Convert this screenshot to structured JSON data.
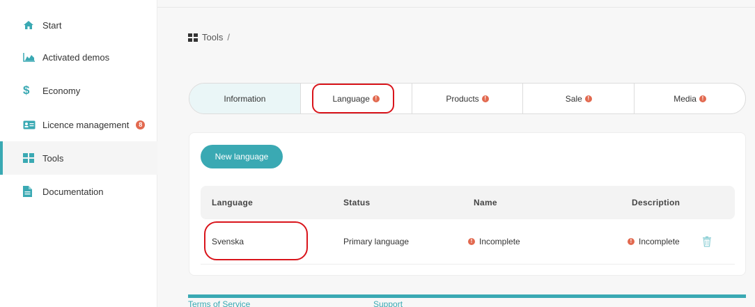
{
  "sidebar": {
    "items": [
      {
        "label": "Start",
        "icon": "home-icon"
      },
      {
        "label": "Activated demos",
        "icon": "chart-area-icon"
      },
      {
        "label": "Economy",
        "icon": "dollar-icon"
      },
      {
        "label": "Licence management",
        "icon": "id-card-icon",
        "badge": "8"
      },
      {
        "label": "Tools",
        "icon": "grid-icon",
        "active": true
      },
      {
        "label": "Documentation",
        "icon": "file-icon"
      }
    ]
  },
  "breadcrumb": {
    "label": "Tools",
    "separator": "/"
  },
  "tabs": [
    {
      "label": "Information",
      "warning": false
    },
    {
      "label": "Language",
      "warning": true
    },
    {
      "label": "Products",
      "warning": true
    },
    {
      "label": "Sale",
      "warning": true
    },
    {
      "label": "Media",
      "warning": true
    }
  ],
  "new_language_button": "New language",
  "table": {
    "headers": [
      "Language",
      "Status",
      "Name",
      "Description"
    ],
    "rows": [
      {
        "language": "Svenska",
        "status": "Primary language",
        "name": "Incomplete",
        "description": "Incomplete"
      }
    ]
  },
  "footer": {
    "terms": "Terms of Service",
    "support": "Support"
  },
  "colors": {
    "accent": "#3aa9b3",
    "warning": "#e2694f",
    "annotation": "#d9141b"
  }
}
